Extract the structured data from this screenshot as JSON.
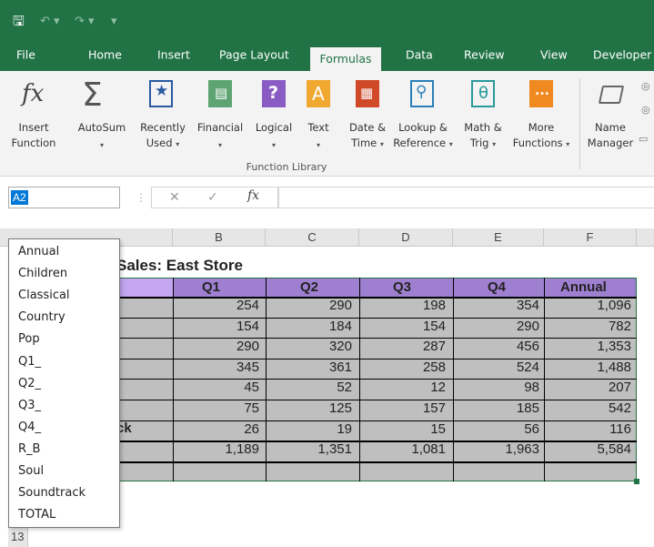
{
  "quick_access": {
    "save_icon": "save-icon",
    "undo_icon": "undo-icon",
    "redo_icon": "redo-icon"
  },
  "tabs": [
    "File",
    "Home",
    "Insert",
    "Page Layout",
    "Formulas",
    "Data",
    "Review",
    "View",
    "Developer"
  ],
  "active_tab": "Formulas",
  "ribbon": {
    "insert_function": {
      "line1": "Insert",
      "line2": "Function",
      "icon": "fx"
    },
    "autosum": {
      "label": "AutoSum",
      "icon": "Σ"
    },
    "recently_used": {
      "line1": "Recently",
      "line2": "Used"
    },
    "financial": {
      "label": "Financial"
    },
    "logical": {
      "label": "Logical",
      "icon": "?"
    },
    "text": {
      "label": "Text",
      "icon": "A"
    },
    "date_time": {
      "line1": "Date &",
      "line2": "Time"
    },
    "lookup": {
      "line1": "Lookup &",
      "line2": "Reference"
    },
    "math": {
      "line1": "Math &",
      "line2": "Trig",
      "icon": "θ"
    },
    "more": {
      "line1": "More",
      "line2": "Functions",
      "icon": "..."
    },
    "name_manager": {
      "line1": "Name",
      "line2": "Manager"
    },
    "group_label": "Function Library"
  },
  "formula_bar": {
    "name_box": "A2",
    "cancel": "✕",
    "enter": "✓",
    "fx": "fx"
  },
  "columns": [
    "B",
    "C",
    "D",
    "E",
    "F"
  ],
  "sheet": {
    "title_partial": "Sales: East Store",
    "headers": [
      "Q1",
      "Q2",
      "Q3",
      "Q4",
      "Annual"
    ],
    "partial_label_row7": "ck",
    "rows": [
      [
        "254",
        "290",
        "198",
        "354",
        "1,096"
      ],
      [
        "154",
        "184",
        "154",
        "290",
        "782"
      ],
      [
        "290",
        "320",
        "287",
        "456",
        "1,353"
      ],
      [
        "345",
        "361",
        "258",
        "524",
        "1,488"
      ],
      [
        "45",
        "52",
        "12",
        "98",
        "207"
      ],
      [
        "75",
        "125",
        "157",
        "185",
        "542"
      ],
      [
        "26",
        "19",
        "15",
        "56",
        "116"
      ],
      [
        "1,189",
        "1,351",
        "1,081",
        "1,963",
        "5,584"
      ]
    ],
    "row_13": "13"
  },
  "name_dropdown": [
    "Annual",
    "Children",
    "Classical",
    "Country",
    "Pop",
    "Q1_",
    "Q2_",
    "Q3_",
    "Q4_",
    "R_B",
    "Soul",
    "Soundtrack",
    "TOTAL"
  ],
  "colors": {
    "excel_green": "#217346",
    "header_purple": "#9f7fd0",
    "cell_gray": "#bfbfbf",
    "label_lavender": "#c4a5f0"
  }
}
